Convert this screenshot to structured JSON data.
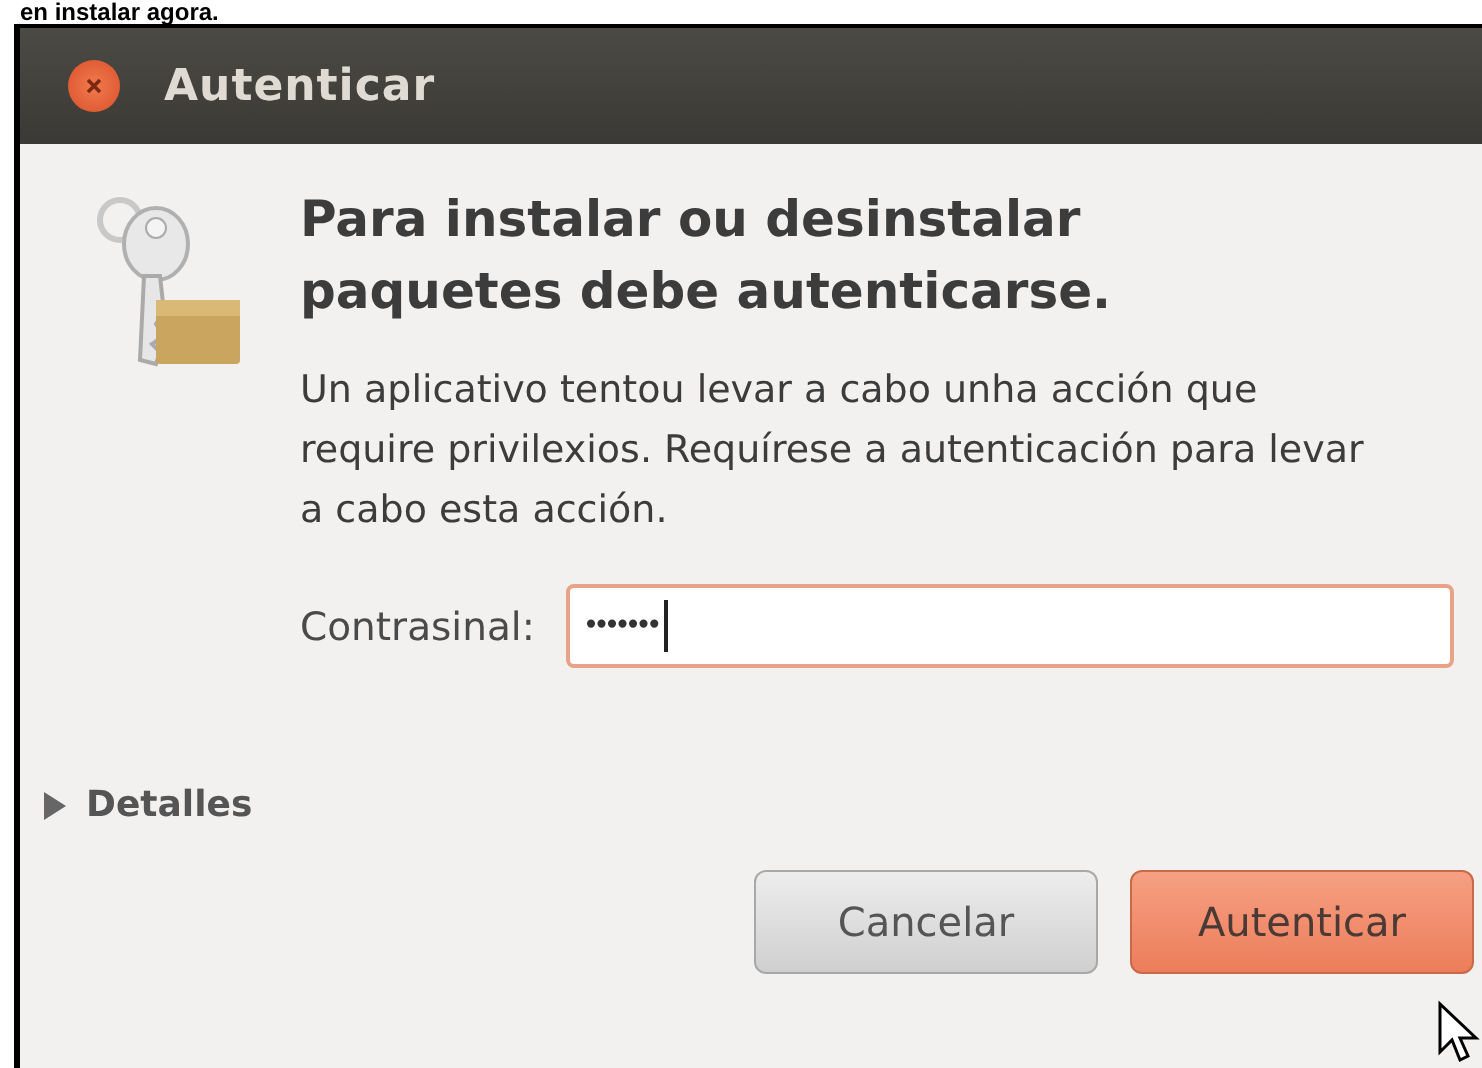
{
  "caption": "en instalar agora.",
  "window": {
    "title": "Autenticar"
  },
  "dialog": {
    "heading": "Para instalar ou desinstalar paquetes debe autenticarse.",
    "message": "Un aplicativo tentou levar a cabo unha acción que require privilexios. Requírese a autenticación para levar a cabo esta acción.",
    "password": {
      "label": "Contrasinal:",
      "value": "•••••••",
      "focused": true
    },
    "details": {
      "label": "Detalles",
      "expanded": false
    },
    "buttons": [
      {
        "label": "Cancelar",
        "kind": "secondary"
      },
      {
        "label": "Autenticar",
        "kind": "primary"
      }
    ]
  }
}
